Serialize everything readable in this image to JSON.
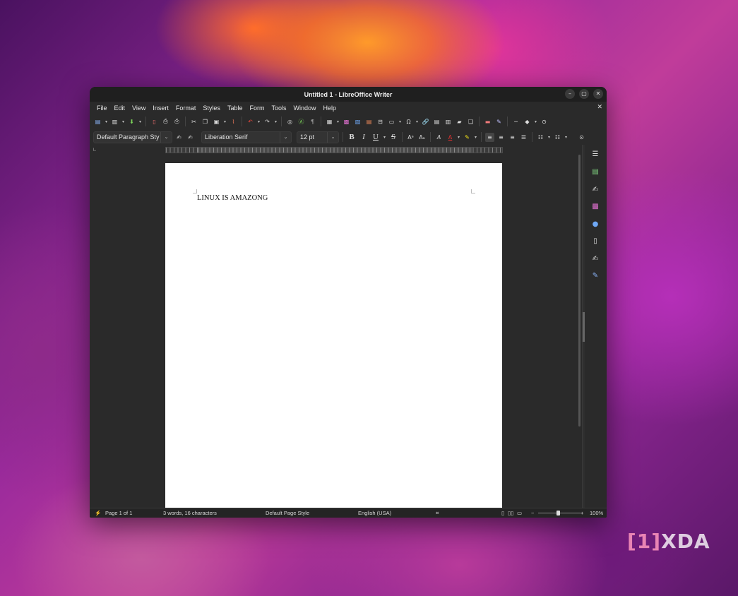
{
  "window": {
    "title": "Untitled 1 - LibreOffice Writer"
  },
  "menu": [
    "File",
    "Edit",
    "View",
    "Insert",
    "Format",
    "Styles",
    "Table",
    "Form",
    "Tools",
    "Window",
    "Help"
  ],
  "formatting": {
    "paragraph_style": "Default Paragraph Sty",
    "font_name": "Liberation Serif",
    "font_size": "12 pt",
    "bold": "B",
    "italic": "I",
    "underline": "U",
    "strikethrough": "S"
  },
  "document": {
    "text": "LINUX IS AMAZONG"
  },
  "status": {
    "page": "Page 1 of 1",
    "words": "3 words, 16 characters",
    "page_style": "Default Page Style",
    "language": "English (USA)",
    "zoom": "100%"
  },
  "watermark": {
    "bracket": "[1]",
    "brand": "XDA"
  },
  "colors": {
    "window_bg": "#2a2a2a",
    "page_bg": "#ffffff",
    "undo_red": "#e0453a",
    "font_color_red": "#e03030",
    "highlight_yellow": "#f5e61a"
  }
}
